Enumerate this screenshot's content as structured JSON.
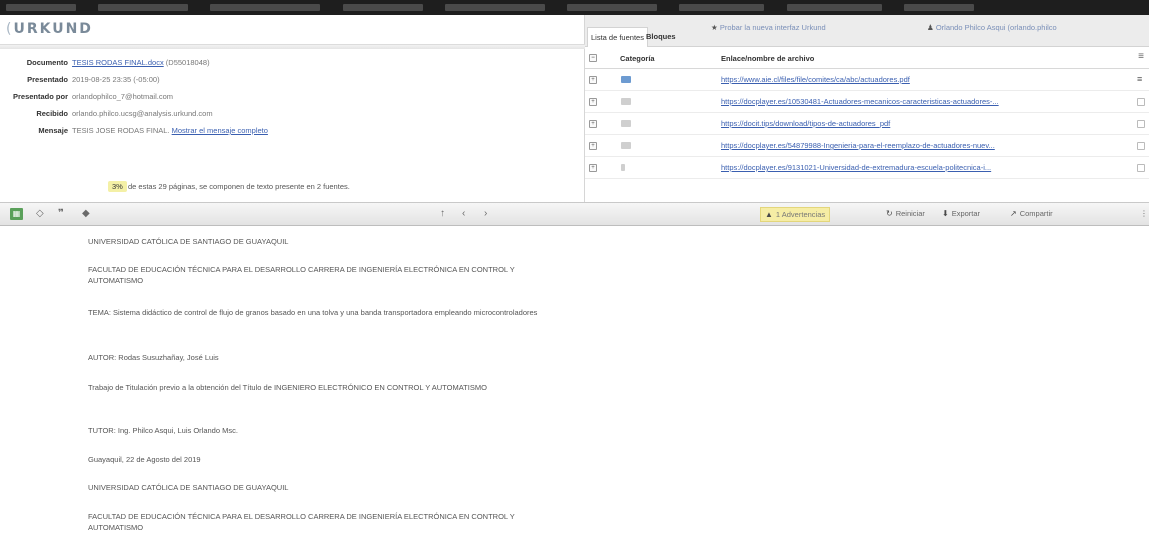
{
  "app": {
    "logo": "URKUND"
  },
  "document_info": {
    "rows": [
      {
        "label": "Documento",
        "value": "TESIS RODAS FINAL.docx",
        "extra": " (D55018048)"
      },
      {
        "label": "Presentado",
        "value": "2019-08-25 23:35 (-05:00)",
        "extra": ""
      },
      {
        "label": "Presentado por",
        "value": "orlandophilco_7@hotmail.com",
        "extra": ""
      },
      {
        "label": "Recibido",
        "value": "orlando.philco.ucsg@analysis.urkund.com",
        "extra": ""
      },
      {
        "label": "Mensaje",
        "value": "TESIS JOSE RODAS FINAL",
        "extra": "Mostrar el mensaje completo"
      }
    ],
    "score_badge": "3%",
    "score_text": "de estas 29 páginas, se componen de texto presente en 2 fuentes."
  },
  "sources_panel": {
    "tabs": [
      "Lista de fuentes",
      "Bloques"
    ],
    "try_new": "Probar la nueva interfaz Urkund",
    "user": "Orlando Philco Asqui (orlando.philco",
    "col_category": "Categoría",
    "col_link": "Enlace/nombre de archivo",
    "rows": [
      {
        "link": "https://www.aie.cl/files/file/comites/ca/abc/actuadores.pdf",
        "icon": "blue"
      },
      {
        "link": "https://docplayer.es/10530481-Actuadores-mecanicos-caracteristicas-actuadores-...",
        "icon": "grey"
      },
      {
        "link": "https://docit.tips/download/tipos-de-actuadores_pdf",
        "icon": "grey"
      },
      {
        "link": "https://docplayer.es/54879988-Ingenieria-para-el-reemplazo-de-actuadores-nuev...",
        "icon": "grey"
      },
      {
        "link": "https://docplayer.es/9131021-Universidad-de-extremadura-escuela-politecnica-i...",
        "icon": "grey"
      }
    ]
  },
  "toolbar": {
    "warnings": "1 Advertencias",
    "reset": "Reiniciar",
    "export": "Exportar",
    "share": "Compartir"
  },
  "document_body": {
    "paragraphs": [
      "UNIVERSIDAD CATÓLICA DE SANTIAGO DE GUAYAQUIL",
      "FACULTAD DE EDUCACIÓN TÉCNICA PARA EL DESARROLLO CARRERA DE INGENIERÍA ELECTRÓNICA EN CONTROL Y AUTOMATISMO",
      "TEMA: Sistema didáctico de control de flujo de granos basado en una tolva y una banda transportadora empleando microcontroladores",
      "AUTOR: Rodas Susuzhañay, José Luis",
      "Trabajo de Titulación previo a la obtención del Título de INGENIERO ELECTRÓNICO EN CONTROL Y AUTOMATISMO",
      "TUTOR: Ing. Philco Asqui, Luis Orlando Msc.",
      "Guayaquil, 22 de Agosto del 2019",
      "UNIVERSIDAD CATÓLICA DE SANTIAGO DE GUAYAQUIL",
      "FACULTAD DE EDUCACIÓN TÉCNICA PARA EL DESARROLLO CARRERA DE INGENIERÍA ELECTRÓNICA EN CONTROL Y AUTOMATISMO"
    ]
  }
}
